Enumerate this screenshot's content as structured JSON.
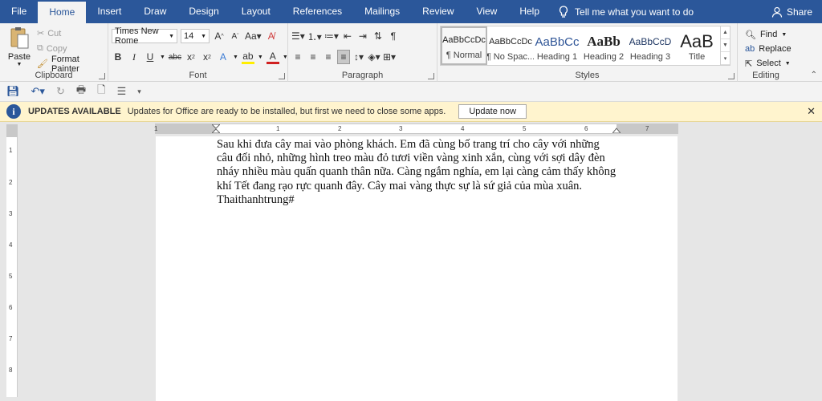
{
  "tabs": [
    "File",
    "Home",
    "Insert",
    "Draw",
    "Design",
    "Layout",
    "References",
    "Mailings",
    "Review",
    "View",
    "Help"
  ],
  "tell_me": "Tell me what you want to do",
  "share": "Share",
  "clipboard": {
    "paste": "Paste",
    "cut": "Cut",
    "copy": "Copy",
    "format_painter": "Format Painter",
    "label": "Clipboard"
  },
  "font": {
    "name": "Times New Rome",
    "size": "14",
    "label": "Font"
  },
  "paragraph": {
    "label": "Paragraph"
  },
  "styles": {
    "label": "Styles",
    "items": [
      {
        "preview": "AaBbCcDc",
        "name": "¶ Normal"
      },
      {
        "preview": "AaBbCcDc",
        "name": "¶ No Spac..."
      },
      {
        "preview": "AaBbCc",
        "name": "Heading 1"
      },
      {
        "preview": "AaBb",
        "name": "Heading 2"
      },
      {
        "preview": "AaBbCcD",
        "name": "Heading 3"
      },
      {
        "preview": "AaB",
        "name": "Title"
      }
    ]
  },
  "editing": {
    "find": "Find",
    "replace": "Replace",
    "select": "Select",
    "label": "Editing"
  },
  "infobar": {
    "title": "UPDATES AVAILABLE",
    "message": "Updates for Office are ready to be installed, but first we need to close some apps.",
    "button": "Update now"
  },
  "ruler": {
    "h_numbers": [
      "1",
      "1",
      "2",
      "3",
      "4",
      "5",
      "6",
      "7"
    ],
    "v_numbers": [
      "1",
      "2",
      "3",
      "4",
      "5",
      "6",
      "7",
      "8"
    ]
  },
  "document": {
    "lines": [
      "Sau khi đưa cây mai vào phòng khách. Em đã cùng bố trang trí cho cây với những",
      "câu đối nhỏ, những hình treo màu đỏ tươi viền vàng xinh xắn, cùng với sợi dây đèn",
      "nháy nhiều màu quấn quanh thân nữa. Càng ngắm nghía, em lại càng cảm thấy không",
      "khí Tết đang rạo rực quanh đây. Cây mai vàng thực sự là sứ giả của mùa xuân.",
      "Thaithanhtrung#"
    ]
  }
}
